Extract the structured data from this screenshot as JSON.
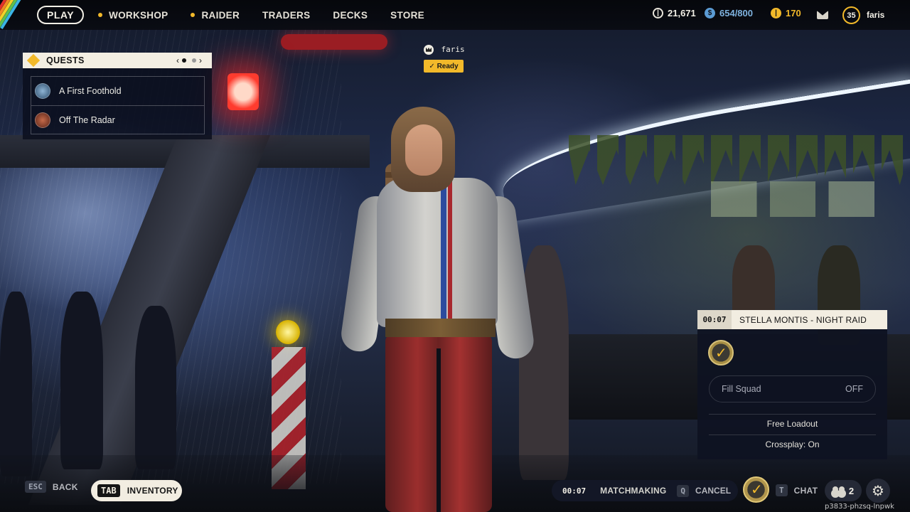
{
  "nav": {
    "play": "PLAY",
    "items": [
      {
        "label": "WORKSHOP",
        "dot": true
      },
      {
        "label": "RAIDER",
        "dot": true
      },
      {
        "label": "TRADERS",
        "dot": false
      },
      {
        "label": "DECKS",
        "dot": false
      },
      {
        "label": "STORE",
        "dot": false
      }
    ]
  },
  "currencies": {
    "coins": "21,671",
    "tokens": "654/800",
    "credits": "170"
  },
  "profile": {
    "level": "35",
    "name": "faris"
  },
  "quests": {
    "title": "QUESTS",
    "page_current": 1,
    "page_total": 2,
    "items": [
      {
        "name": "A First Foothold"
      },
      {
        "name": "Off The Radar"
      }
    ]
  },
  "player": {
    "name": "faris",
    "status": "Ready"
  },
  "matchmaking_panel": {
    "timer": "00:07",
    "title": "STELLA MONTIS - NIGHT RAID",
    "fill_squad_label": "Fill Squad",
    "fill_squad_value": "OFF",
    "loadout": "Free Loadout",
    "crossplay": "Crossplay: On"
  },
  "bottom": {
    "back_key": "ESC",
    "back_label": "BACK",
    "inventory_key": "TAB",
    "inventory_label": "INVENTORY",
    "mm_timer": "00:07",
    "mm_label": "MATCHMAKING",
    "cancel_key": "Q",
    "cancel_label": "CANCEL",
    "chat_key": "T",
    "chat_label": "CHAT",
    "party_count": "2",
    "session_id": "p3833-phzsq-lnpwk"
  },
  "colors": {
    "accent": "#f2b92a",
    "panel_bg": "#0e1222",
    "header_bg": "#f2ede1"
  }
}
